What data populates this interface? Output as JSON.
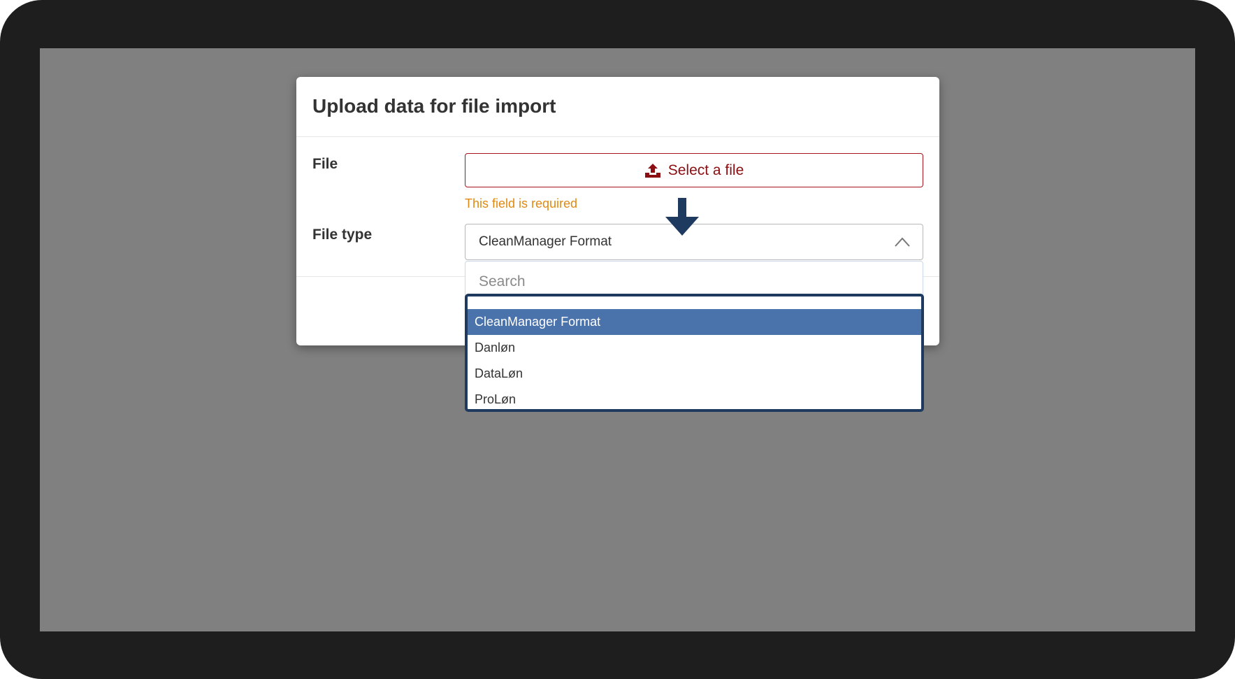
{
  "modal": {
    "title": "Upload data for file import"
  },
  "form": {
    "file_label": "File",
    "file_type_label": "File type",
    "select_file_button": "Select a file",
    "error_text": "This field is required",
    "selected_value": "CleanManager Format",
    "search_placeholder": "Search",
    "options": [
      {
        "label": "CleanManager Format",
        "selected": true
      },
      {
        "label": "Danløn",
        "selected": false
      },
      {
        "label": "DataLøn",
        "selected": false
      },
      {
        "label": "ProLøn",
        "selected": false
      }
    ]
  },
  "icons": {
    "upload": "upload-icon",
    "chevron": "chevron-up-icon",
    "annotation": "arrow-down-icon"
  },
  "colors": {
    "device_frame": "#1f1e1f",
    "overlay": "#808080",
    "button_border": "#a8141b",
    "button_text": "#8b0e12",
    "error": "#e08a13",
    "selected_option": "#4a72ab",
    "dropdown_border": "#1f3a5f"
  }
}
